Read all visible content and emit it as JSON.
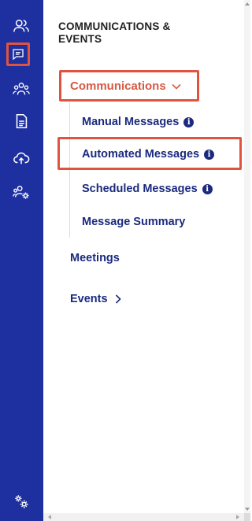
{
  "rail": {
    "icons": [
      {
        "name": "people-icon"
      },
      {
        "name": "chat-icon",
        "active": true
      },
      {
        "name": "groups-icon"
      },
      {
        "name": "document-icon"
      },
      {
        "name": "cloud-upload-icon"
      },
      {
        "name": "group-settings-icon"
      },
      {
        "name": "settings-icon"
      }
    ]
  },
  "panel": {
    "heading": "COMMUNICATIONS & EVENTS",
    "communications_label": "Communications",
    "submenu": [
      {
        "label": "Manual Messages",
        "info": "i"
      },
      {
        "label": "Automated Messages",
        "info": "i"
      },
      {
        "label": "Scheduled Messages",
        "info": "i"
      },
      {
        "label": "Message Summary"
      }
    ],
    "meetings_label": "Meetings",
    "events_label": "Events"
  },
  "colors": {
    "rail_bg": "#1e2fa0",
    "accent_red": "#e0533e",
    "nav_text": "#1b2a7e",
    "active_text": "#d65a43"
  }
}
